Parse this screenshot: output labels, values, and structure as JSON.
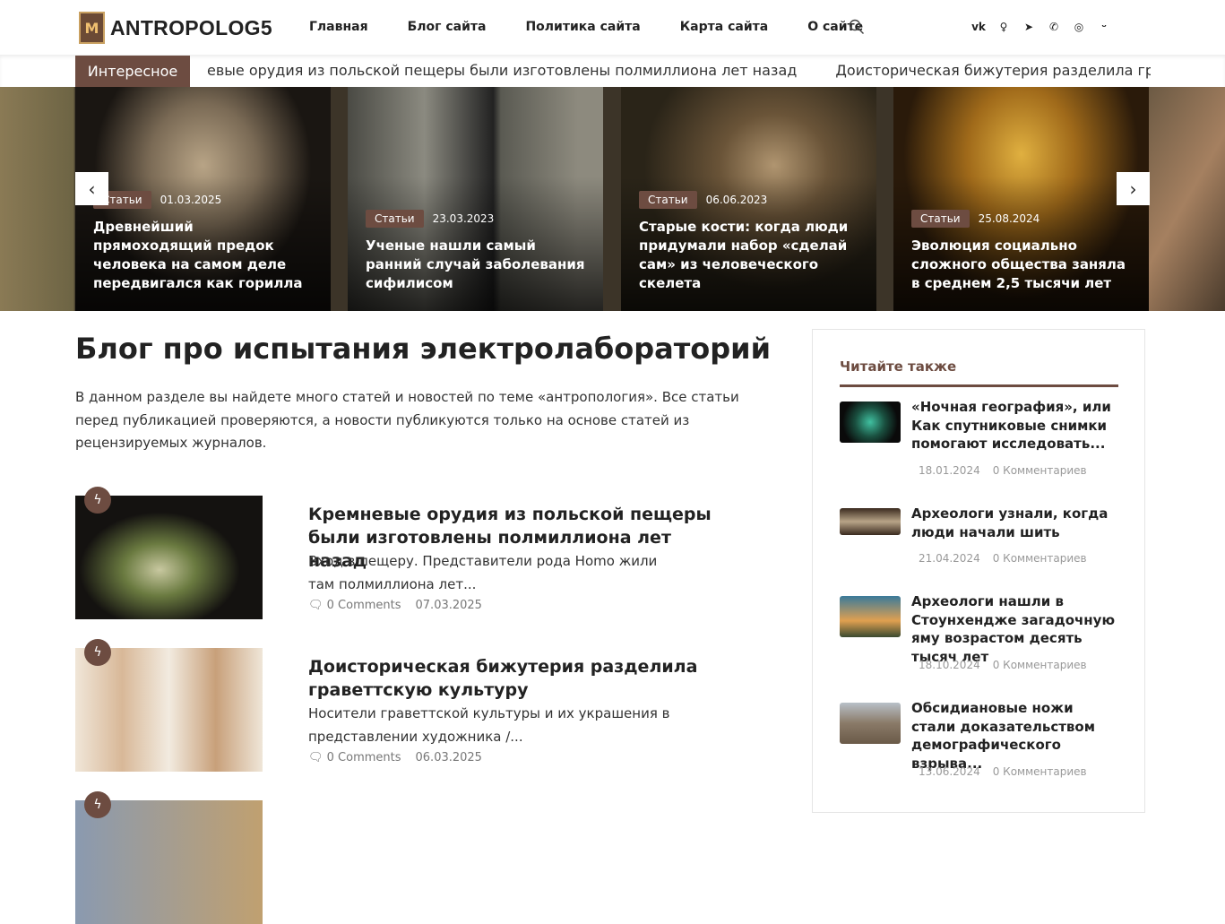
{
  "header": {
    "logo_text": "ANTROPOLOG5",
    "logo_mark": "M",
    "nav": [
      "Главная",
      "Блог сайта",
      "Политика сайта",
      "Карта сайта",
      "О сайте"
    ],
    "social": [
      "vk",
      "ok",
      "telegram",
      "viber",
      "whatsapp",
      "max"
    ]
  },
  "ticker": {
    "label": "Интересное",
    "items": [
      "евые орудия из польской пещеры были изготовлены полмиллиона лет назад",
      "Доисторическая бижутерия разделила граветтскую культур"
    ]
  },
  "slider": {
    "prev": "‹",
    "next": "›",
    "cards": [
      {
        "category": "Статьи",
        "date": "01.03.2025",
        "title": "Древнейший прямоходящий предок человека на самом деле передвигался как горилла"
      },
      {
        "category": "Статьи",
        "date": "23.03.2023",
        "title": "Ученые нашли самый ранний случай заболевания сифилисом"
      },
      {
        "category": "Статьи",
        "date": "06.06.2023",
        "title": "Старые кости: когда люди придумали набор «сделай сам» из человеческого скелета"
      },
      {
        "category": "Статьи",
        "date": "25.08.2024",
        "title": "Эволюция социально сложного общества заняла в среднем 2,5 тысячи лет"
      }
    ]
  },
  "main": {
    "title": "Блог про испытания электролабораторий",
    "intro": "В данном разделе вы найдете много статей и новостей по теме «антропология». Все статьи перед публикацией проверяются, а новости публикуются только на основе статей из рецензируемых журналов.",
    "posts": [
      {
        "title": "Кремневые орудия из польской пещеры были изготовлены полмиллиона лет назад",
        "excerpt": "Вход в пещеру. Представители рода Homo жили там полмиллиона лет...",
        "comments": "0 Comments",
        "date": "07.03.2025"
      },
      {
        "title": "Доисторическая бижутерия разделила граветтскую культуру",
        "excerpt": "Носители граветтской культуры и их украшения в представлении художника /...",
        "comments": "0 Comments",
        "date": "06.03.2025"
      }
    ]
  },
  "sidebar": {
    "title": "Читайте также",
    "items": [
      {
        "title": "«Ночная география», или Как спутниковые снимки помогают исследовать...",
        "date": "18.01.2024",
        "comments": "0 Комментариев"
      },
      {
        "title": "Археологи узнали, когда люди начали шить",
        "date": "21.04.2024",
        "comments": "0 Комментариев"
      },
      {
        "title": "Археологи нашли в Стоунхендже загадочную яму возрастом десять тысяч лет",
        "date": "18.10.2024",
        "comments": "0 Комментариев"
      },
      {
        "title": "Обсидиановые ножи стали доказательством демографического взрыва...",
        "date": "13.06.2024",
        "comments": "0 Комментариев"
      }
    ]
  },
  "colors": {
    "accent": "#6d4c41"
  }
}
